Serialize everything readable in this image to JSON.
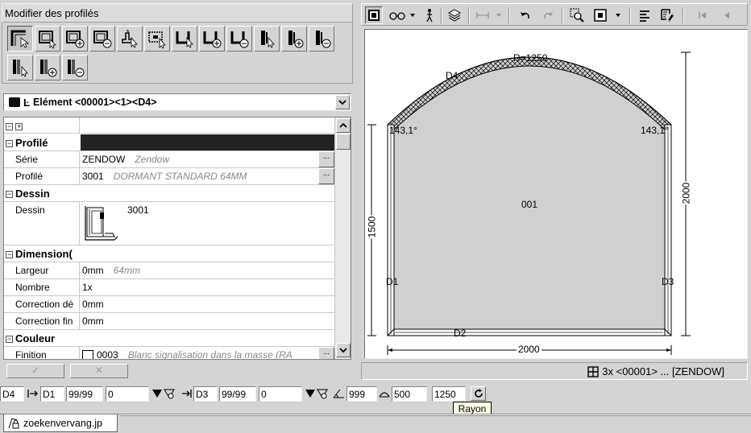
{
  "panel": {
    "title": "Modifier des profilés"
  },
  "element": {
    "label": "Elément <00001><1><D4>"
  },
  "grid": {
    "rows": [
      {
        "type": "cat",
        "name": "Profilé"
      },
      {
        "type": "prop",
        "name": "Série",
        "value": "ZENDOW",
        "desc": "Zendow",
        "ellipsis": "..."
      },
      {
        "type": "prop",
        "name": "Profilé",
        "value": "3001",
        "desc": "DORMANT STANDARD 64MM",
        "ellipsis": "..."
      },
      {
        "type": "cat",
        "name": "Dessin"
      },
      {
        "type": "prop",
        "name": "Dessin",
        "value": "3001"
      },
      {
        "type": "cat",
        "name": "Dimension("
      },
      {
        "type": "prop",
        "name": "Largeur",
        "value": "0mm",
        "desc": "64mm"
      },
      {
        "type": "prop",
        "name": "Nombre",
        "value": "1x"
      },
      {
        "type": "prop",
        "name": "Correction dé",
        "value": "0mm"
      },
      {
        "type": "prop",
        "name": "Correction fin",
        "value": "0mm"
      },
      {
        "type": "cat",
        "name": "Couleur"
      },
      {
        "type": "prop",
        "name": "Finition",
        "value": "0003",
        "desc": "Blanc signalisation dans la masse (RA",
        "ellipsis": "..."
      }
    ]
  },
  "buttons": {
    "ok": "✓",
    "cancel": "✕"
  },
  "drawing": {
    "radius_label": "R=1250",
    "d4": "D4",
    "d1": "D1",
    "d2": "D2",
    "d3": "D3",
    "angle_left": "143,1°",
    "angle_right": "143,1°",
    "center": "001",
    "dim_left": "1500",
    "dim_right": "2000",
    "dim_bottom": "2000"
  },
  "status": {
    "text": "3x <00001> ... [ZENDOW]"
  },
  "input_bar": {
    "f1": "D4",
    "f2": "D1",
    "f3": "99/99",
    "f4": "0",
    "f5": "D3",
    "f6": "99/99",
    "f7": "0",
    "f8": "999",
    "f9": "500",
    "f10": "1250"
  },
  "tooltip": "Rayon",
  "tab": {
    "label": "zoekenvervang.jp"
  }
}
